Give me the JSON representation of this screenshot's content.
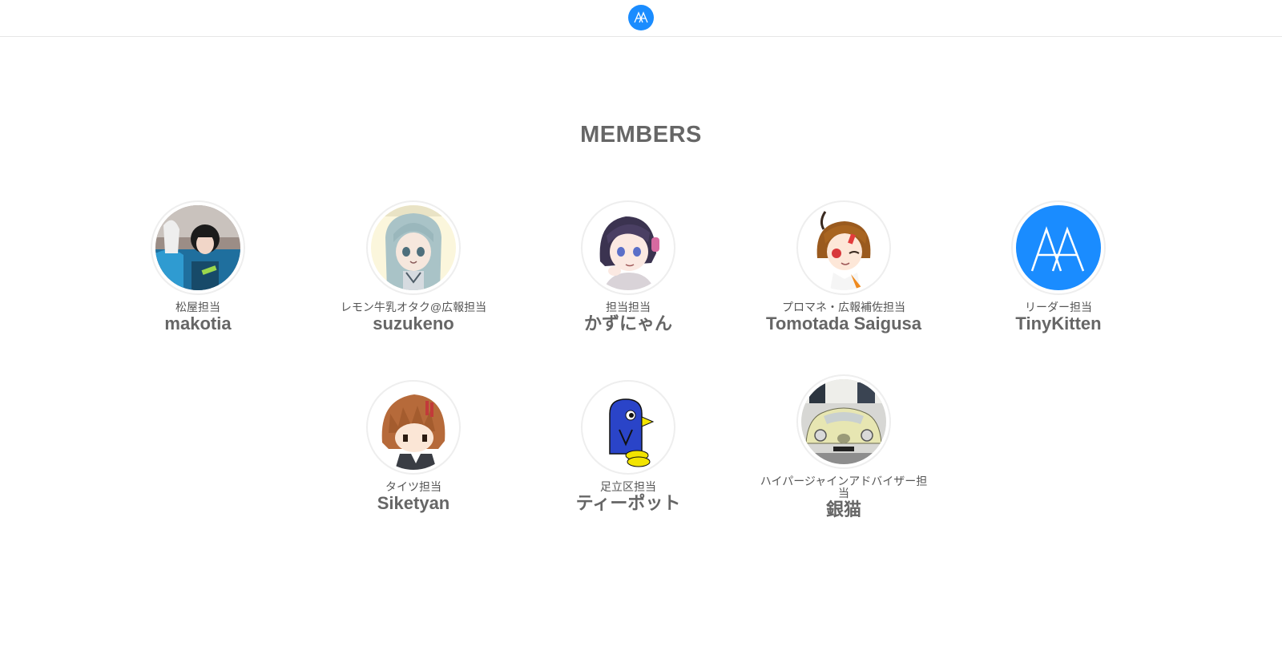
{
  "header": {
    "logo_icon": "team-logo-icon",
    "accent_color": "#1a8cff"
  },
  "section": {
    "title": "MEMBERS"
  },
  "members": [
    {
      "role": "松屋担当",
      "name": "makotia",
      "avatar": "photo-avatar-girl"
    },
    {
      "role": "レモン牛乳オタク@広報担当",
      "name": "suzukeno",
      "avatar": "anime-avatar-silver-hair"
    },
    {
      "role": "担当担当",
      "name": "かずにゃん",
      "avatar": "anime-avatar-purple-hair"
    },
    {
      "role": "プロマネ・広報補佐担当",
      "name": "Tomotada Saigusa",
      "avatar": "anime-avatar-orange-hair"
    },
    {
      "role": "リーダー担当",
      "name": "TinyKitten",
      "avatar": "team-logo-avatar"
    },
    {
      "role": "タイツ担当",
      "name": "Siketyan",
      "avatar": "anime-avatar-brown-hair"
    },
    {
      "role": "足立区担当",
      "name": "ティーポット",
      "avatar": "blue-bird-avatar"
    },
    {
      "role": "ハイパージャインアドバイザー担当",
      "name": "銀猫",
      "avatar": "vintage-car-avatar"
    }
  ]
}
